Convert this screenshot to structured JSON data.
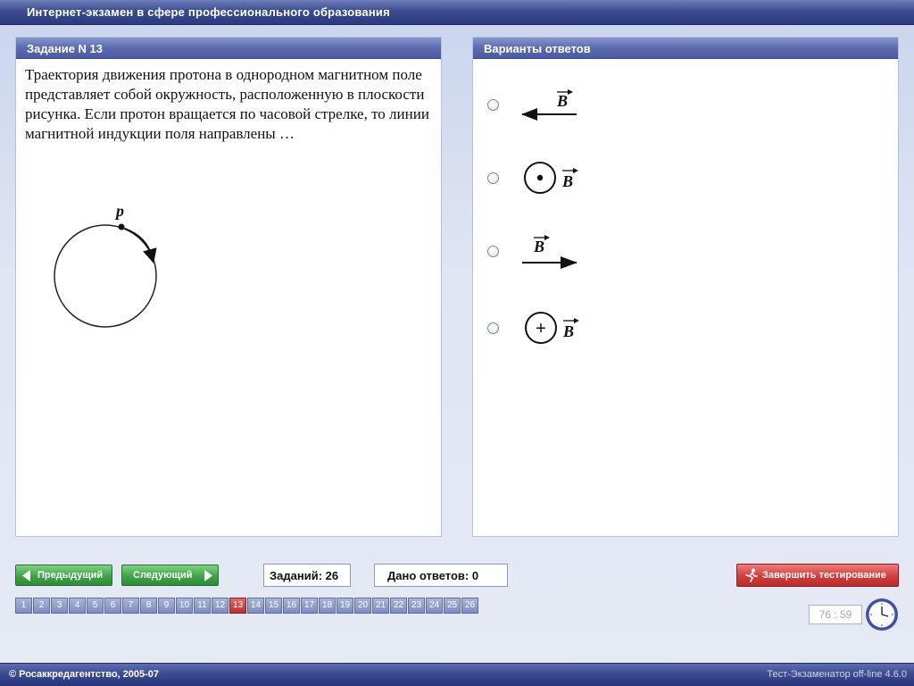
{
  "header": {
    "title": "Интернет-экзамен в сфере профессионального образования"
  },
  "task_panel": {
    "title": "Задание N 13",
    "question": "Траектория движения протона в однородном магнитном поле представляет собой окружность, расположенную в плоскости рисунка. Если протон вращается по часовой стрелке, то линии магнитной индукции поля направлены …",
    "figure_label": "p"
  },
  "answers_panel": {
    "title": "Варианты ответов",
    "options": [
      {
        "symbol": "B",
        "depiction": "arrow-left"
      },
      {
        "symbol": "B",
        "depiction": "dot-in-circle"
      },
      {
        "symbol": "B",
        "depiction": "arrow-right"
      },
      {
        "symbol": "B",
        "depiction": "plus-in-circle",
        "inner": "+"
      }
    ]
  },
  "navigation": {
    "prev_label": "Предыдущий",
    "next_label": "Следующий",
    "tasks_count": "Заданий: 26",
    "answers_given": "Дано ответов: 0",
    "finish_label": "Завершить тестирование",
    "pages": [
      "1",
      "2",
      "3",
      "4",
      "5",
      "6",
      "7",
      "8",
      "9",
      "10",
      "11",
      "12",
      "13",
      "14",
      "15",
      "16",
      "17",
      "18",
      "19",
      "20",
      "21",
      "22",
      "23",
      "24",
      "25",
      "26"
    ],
    "current_page": "13"
  },
  "timer": {
    "value": "76 : 59"
  },
  "footer": {
    "copyright": "© Росаккредагентство, 2005-07",
    "version": "Тест-Экзаменатор off-line 4.6.0"
  },
  "colors": {
    "header_blue": "#3d4c91",
    "nav_green": "#3fa447",
    "finish_red": "#d43d3d",
    "active_page_red": "#b83232",
    "page_blue": "#7d8cc2"
  }
}
